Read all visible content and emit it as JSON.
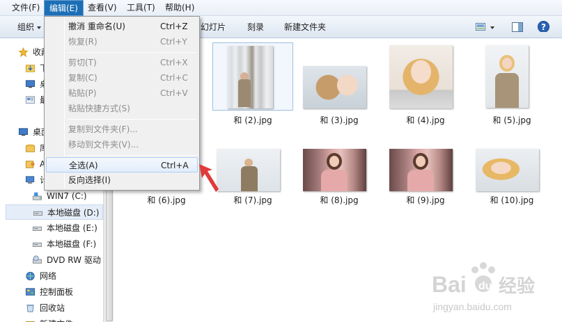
{
  "menubar": {
    "items": [
      "文件(F)",
      "编辑(E)",
      "查看(V)",
      "工具(T)",
      "帮助(H)"
    ],
    "active_index": 1
  },
  "toolbar": {
    "organize": "组织",
    "slideshow": "幻灯片",
    "burn": "刻录",
    "new_folder": "新建文件夹",
    "help_icon": "help-icon",
    "view_icon": "view-icon",
    "preview_icon": "preview-pane-icon"
  },
  "sidebar": {
    "items": [
      {
        "label": "收藏",
        "icon": "star-icon"
      },
      {
        "label": "下",
        "icon": "downloads-icon"
      },
      {
        "label": "桌",
        "icon": "desktop-icon"
      },
      {
        "label": "最",
        "icon": "recent-icon"
      },
      {
        "label": "桌面",
        "icon": "desktop-icon"
      },
      {
        "label": "库",
        "icon": "library-icon"
      },
      {
        "label": "A",
        "icon": "user-folder-icon"
      },
      {
        "label": "计",
        "icon": "computer-icon"
      },
      {
        "label": "WIN7 (C:)",
        "icon": "system-drive-icon"
      },
      {
        "label": "本地磁盘 (D:)",
        "icon": "drive-icon"
      },
      {
        "label": "本地磁盘 (E:)",
        "icon": "drive-icon"
      },
      {
        "label": "本地磁盘 (F:)",
        "icon": "drive-icon"
      },
      {
        "label": "DVD RW 驱动",
        "icon": "dvd-drive-icon"
      },
      {
        "label": "网络",
        "icon": "network-icon"
      },
      {
        "label": "控制面板",
        "icon": "control-panel-icon"
      },
      {
        "label": "回收站",
        "icon": "recycle-bin-icon"
      },
      {
        "label": "新建文件",
        "icon": "folder-icon"
      }
    ]
  },
  "edit_menu": {
    "items": [
      {
        "label": "撤消 重命名(U)",
        "shortcut": "Ctrl+Z",
        "disabled": false
      },
      {
        "label": "恢复(R)",
        "shortcut": "Ctrl+Y",
        "disabled": true
      },
      {
        "label": "剪切(T)",
        "shortcut": "Ctrl+X",
        "disabled": true
      },
      {
        "label": "复制(C)",
        "shortcut": "Ctrl+C",
        "disabled": true
      },
      {
        "label": "粘贴(P)",
        "shortcut": "Ctrl+V",
        "disabled": true
      },
      {
        "label": "粘贴快捷方式(S)",
        "shortcut": "",
        "disabled": true
      },
      {
        "label": "复制到文件夹(F)...",
        "shortcut": "",
        "disabled": true
      },
      {
        "label": "移动到文件夹(V)...",
        "shortcut": "",
        "disabled": true
      },
      {
        "label": "全选(A)",
        "shortcut": "Ctrl+A",
        "disabled": false,
        "highlighted": true
      },
      {
        "label": "反向选择(I)",
        "shortcut": "",
        "disabled": false
      }
    ]
  },
  "files": [
    {
      "name": "和 (2).jpg",
      "selected": true
    },
    {
      "name": "和 (3).jpg"
    },
    {
      "name": "和 (4).jpg"
    },
    {
      "name": "和 (5).jpg"
    },
    {
      "name": "和 (6).jpg"
    },
    {
      "name": "和 (7).jpg"
    },
    {
      "name": "和 (8).jpg"
    },
    {
      "name": "和 (9).jpg"
    },
    {
      "name": "和 (10).jpg"
    }
  ],
  "watermark": {
    "brand": "Bai",
    "brand2": "du",
    "cn": "经验",
    "url": "jingyan.baidu.com"
  },
  "colors": {
    "menu_active": "#1c6fb6",
    "highlight_border": "#aecff7",
    "annotation_arrow": "#e03a3a"
  }
}
